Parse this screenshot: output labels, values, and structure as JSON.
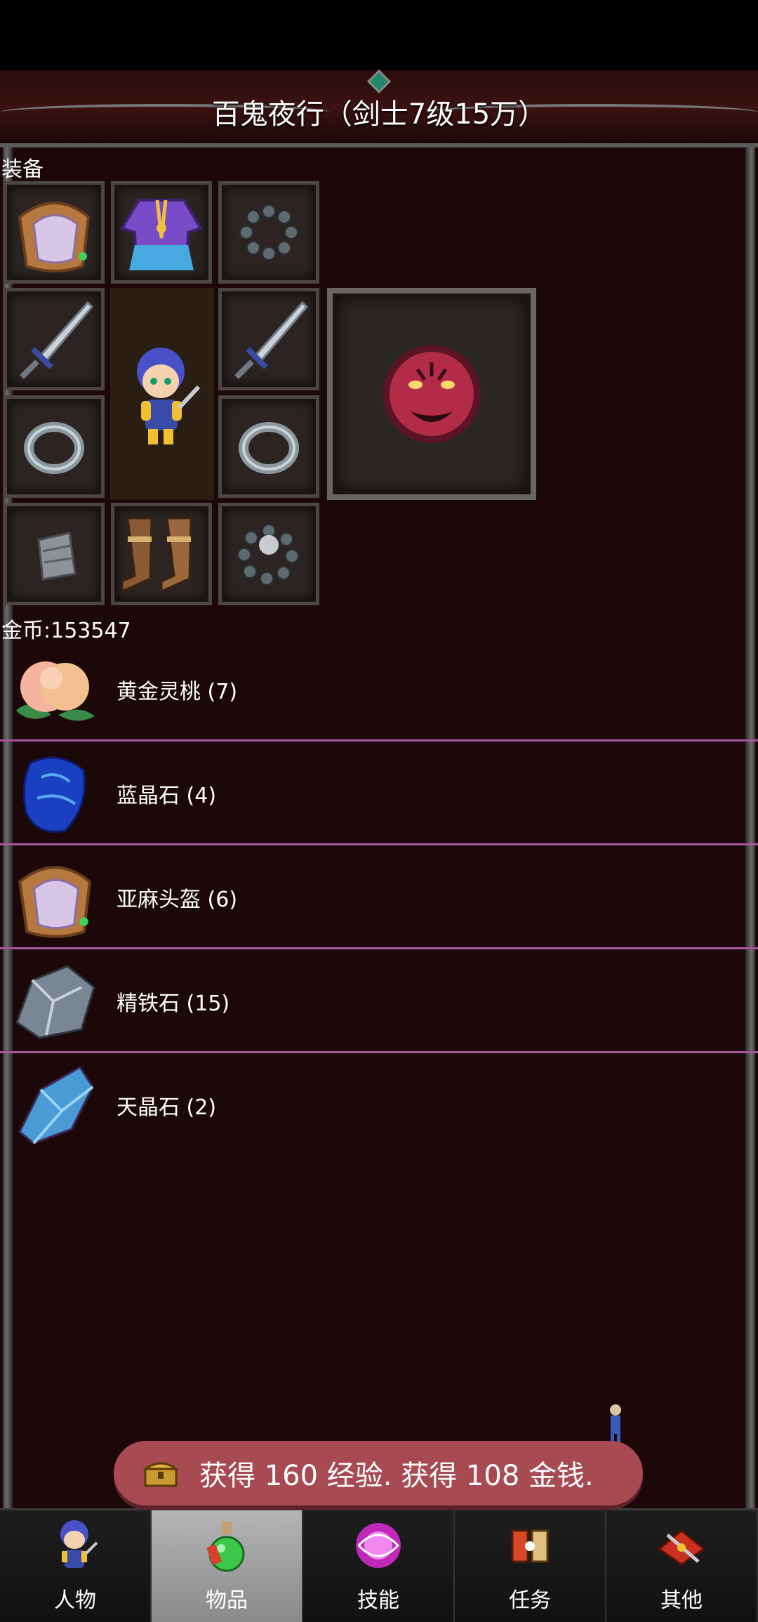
{
  "title": "百鬼夜行（剑士7级15万）",
  "equipment": {
    "section_label": "装备",
    "slots": [
      {
        "name": "helmet",
        "icon": "helmet-icon"
      },
      {
        "name": "robe",
        "icon": "robe-icon"
      },
      {
        "name": "necklace",
        "icon": "bead-necklace-icon"
      },
      {
        "name": "weapon-left",
        "icon": "sword-icon"
      },
      {
        "name": "weapon-right",
        "icon": "sword-icon"
      },
      {
        "name": "ring-left",
        "icon": "ring-icon"
      },
      {
        "name": "ring-right",
        "icon": "ring-icon"
      },
      {
        "name": "bracer",
        "icon": "bracer-icon"
      },
      {
        "name": "boots",
        "icon": "boots-icon"
      },
      {
        "name": "bracelet",
        "icon": "bracelet-icon"
      }
    ],
    "character": "chibi-swordsman-avatar",
    "special_slot": "tiger-emblem-icon"
  },
  "gold": "金币:153547",
  "items": [
    {
      "label": "黄金灵桃 (7)",
      "icon": "peach-icon"
    },
    {
      "label": "蓝晶石 (4)",
      "icon": "blue-crystal-icon"
    },
    {
      "label": "亚麻头盔 (6)",
      "icon": "helmet-icon"
    },
    {
      "label": "精铁石 (15)",
      "icon": "iron-ore-icon"
    },
    {
      "label": "天晶石 (2)",
      "icon": "sky-crystal-icon"
    }
  ],
  "toast": {
    "text": "获得 160 经验. 获得 108 金钱.",
    "icon": "treasure-chest-icon"
  },
  "nav": [
    {
      "label": "人物",
      "icon": "character-icon",
      "active": false
    },
    {
      "label": "物品",
      "icon": "potion-icon",
      "active": true
    },
    {
      "label": "技能",
      "icon": "skill-orb-icon",
      "active": false
    },
    {
      "label": "任务",
      "icon": "quest-icon",
      "active": false
    },
    {
      "label": "其他",
      "icon": "misc-icon",
      "active": false
    }
  ],
  "colors": {
    "panel_bg": "#1c0808",
    "separator": "#a855a0",
    "toast_bg": "#a84a52",
    "nav_active": "#9f9f9f"
  }
}
